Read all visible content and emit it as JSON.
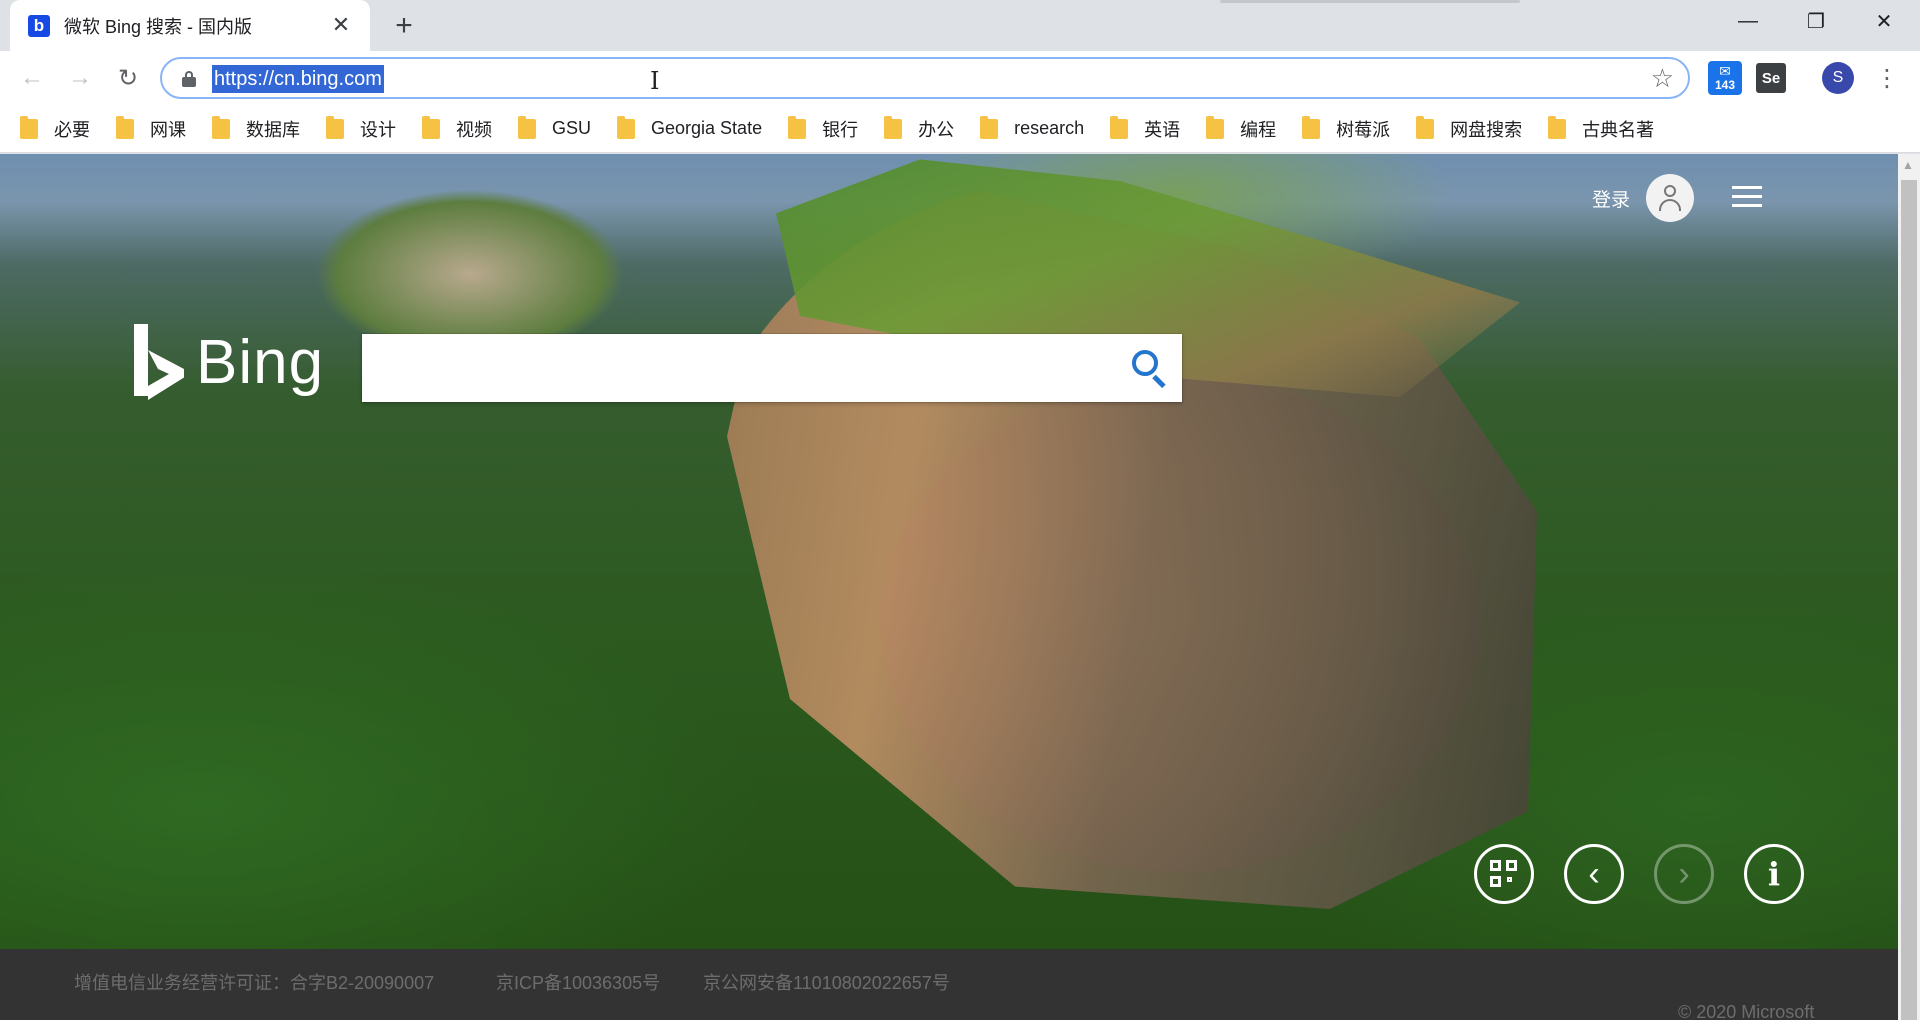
{
  "browser": {
    "tab": {
      "title": "微软 Bing 搜索 - 国内版",
      "favicon": "b",
      "close": "✕"
    },
    "new_tab": "+",
    "window_controls": {
      "minimize": "—",
      "maximize": "❐",
      "close": "✕"
    },
    "nav": {
      "back": "←",
      "forward": "→",
      "reload": "↻"
    },
    "omnibox": {
      "url": "https://cn.bing.com",
      "star": "☆",
      "cursor": "I"
    },
    "extensions": {
      "mail_badge": "143",
      "selenium": "Se",
      "profile_initial": "S",
      "menu": "⋮"
    }
  },
  "bookmarks": [
    "必要",
    "网课",
    "数据库",
    "设计",
    "视频",
    "GSU",
    "Georgia State",
    "银行",
    "办公",
    "research",
    "英语",
    "编程",
    "树莓派",
    "网盘搜索",
    "古典名著"
  ],
  "bing": {
    "signin_label": "登录",
    "logo_text": "Bing",
    "search_placeholder": "",
    "buttons": {
      "prev": "‹",
      "next": "›"
    }
  },
  "footer": {
    "license": "增值电信业务经营许可证：合字B2-20090007",
    "icp": "京ICP备10036305号",
    "police": "京公网安备11010802022657号",
    "copyright": "© 2020 Microsoft"
  },
  "colors": {
    "accent_blue": "#2475ce",
    "url_highlight": "#3367d6",
    "folder": "#f6c244",
    "footer_bg": "#333333"
  },
  "icons": [
    "bing-favicon",
    "lock-icon",
    "star-icon",
    "mail-extension-icon",
    "selenium-extension-icon",
    "user-avatar-icon",
    "hamburger-icon",
    "search-icon",
    "qr-code-icon",
    "chevron-left-icon",
    "chevron-right-icon",
    "info-icon"
  ]
}
